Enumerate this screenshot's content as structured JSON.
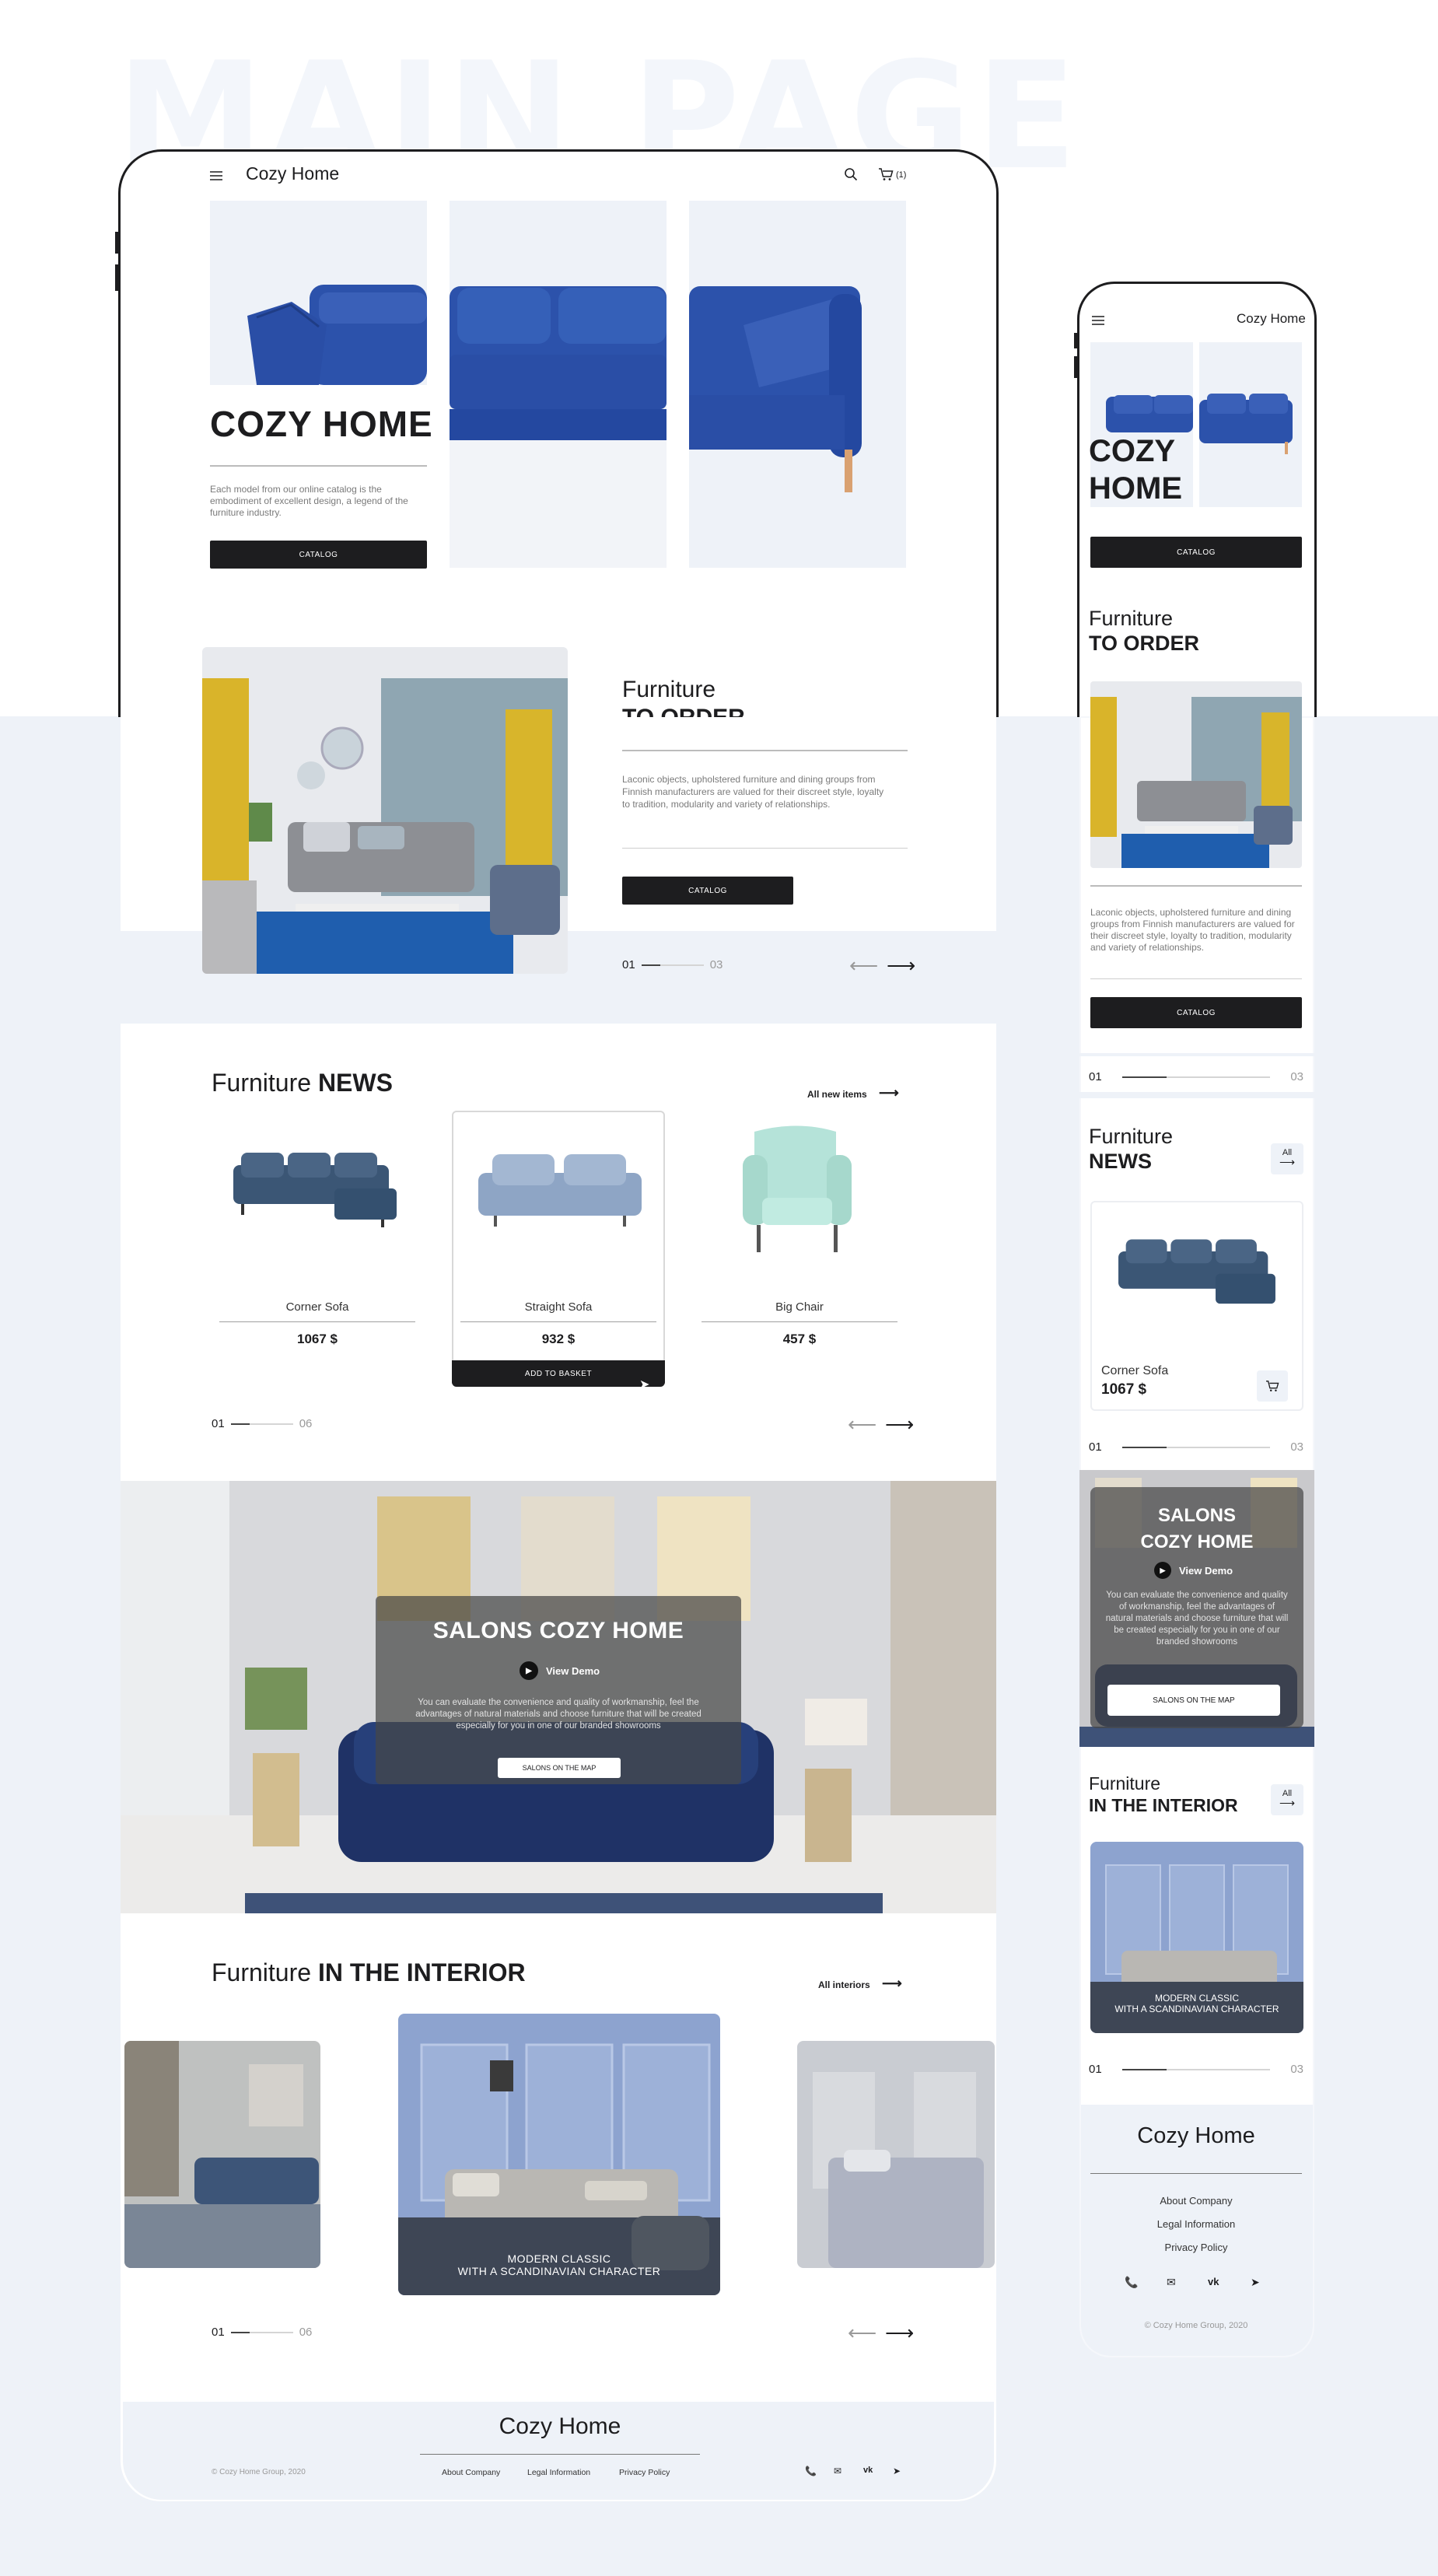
{
  "watermark": "MAIN PAGE",
  "colors": {
    "accent": "#2b4fa9",
    "dark": "#1d1d1f",
    "bg_light": "#eef2f8",
    "muted": "#8a8a8a"
  },
  "desktop": {
    "header": {
      "logo": "Cozy Home",
      "cart_count": "(1)",
      "menu_icon": "hamburger-icon",
      "search_icon": "search-icon",
      "cart_icon": "cart-icon"
    },
    "hero": {
      "title": "COZY HOME",
      "description": "Each model from our online catalog is the embodiment of excellent design, a legend of the furniture industry.",
      "button": "CATALOG"
    },
    "order": {
      "title_light": "Furniture",
      "title_bold": "TO ORDER",
      "description": "Laconic objects, upholstered furniture and dining groups from Finnish manufacturers are valued for their discreet style, loyalty to tradition, modularity and variety of relationships.",
      "button": "CATALOG",
      "page_current": "01",
      "page_total": "03"
    },
    "news": {
      "title_light": "Furniture",
      "title_bold": "NEWS",
      "link": "All new items",
      "items": [
        {
          "name": "Corner Sofa",
          "price": "1067 $"
        },
        {
          "name": "Straight Sofa",
          "price": "932 $"
        },
        {
          "name": "Big Chair",
          "price": "457 $"
        }
      ],
      "add_button": "ADD TO BASKET",
      "page_current": "01",
      "page_total": "06"
    },
    "salons": {
      "title": "SALONS COZY HOME",
      "demo": "View Demo",
      "description": "You can evaluate the convenience and quality of workmanship, feel the advantages of natural materials and choose furniture that will be created especially for you in one of our branded showrooms",
      "button": "SALONS ON THE MAP"
    },
    "interior": {
      "title_light": "Furniture",
      "title_bold": "IN THE INTERIOR",
      "link": "All interiors",
      "caption_line1": "MODERN CLASSIC",
      "caption_line2": "WITH A SCANDINAVIAN CHARACTER",
      "page_current": "01",
      "page_total": "06"
    },
    "footer": {
      "logo": "Cozy Home",
      "copyright": "© Cozy Home Group, 2020",
      "links": [
        "About Company",
        "Legal Information",
        "Privacy Policy"
      ]
    }
  },
  "mobile": {
    "header": {
      "logo": "Cozy Home"
    },
    "hero": {
      "title_line1": "COZY",
      "title_line2": "HOME",
      "button": "CATALOG"
    },
    "order": {
      "title_light": "Furniture",
      "title_bold": "TO ORDER",
      "description": "Laconic objects, upholstered furniture and dining groups from Finnish manufacturers are valued for their discreet style, loyalty to tradition, modularity and variety of relationships.",
      "button": "CATALOG",
      "page_current": "01",
      "page_total": "03"
    },
    "news": {
      "title_light": "Furniture",
      "title_bold": "NEWS",
      "all": "All",
      "item_name": "Corner Sofa",
      "item_price": "1067 $",
      "page_current": "01",
      "page_total": "03"
    },
    "salons": {
      "title_line1": "SALONS",
      "title_line2": "COZY HOME",
      "demo": "View Demo",
      "description": "You can evaluate the convenience and quality of workmanship, feel the advantages of natural materials and choose furniture that will be created especially for you in one of our branded showrooms",
      "button": "SALONS ON THE MAP"
    },
    "interior": {
      "title_light": "Furniture",
      "title_bold": "IN THE INTERIOR",
      "all": "All",
      "caption_line1": "MODERN CLASSIC",
      "caption_line2": "WITH A SCANDINAVIAN CHARACTER",
      "page_current": "01",
      "page_total": "03"
    },
    "footer": {
      "logo": "Cozy Home",
      "links": [
        "About Company",
        "Legal Information",
        "Privacy Policy"
      ],
      "copyright": "© Cozy Home Group, 2020"
    }
  }
}
